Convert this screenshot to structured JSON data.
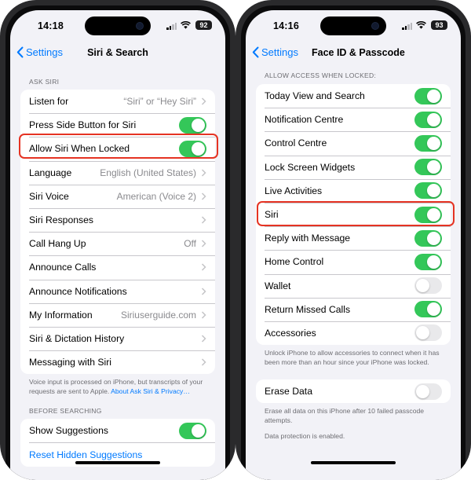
{
  "accent": "#007aff",
  "toggle_on_color": "#34c759",
  "highlight_color": "#e53323",
  "left_phone": {
    "status": {
      "time": "14:18",
      "battery": "92"
    },
    "nav": {
      "back_label": "Settings",
      "title": "Siri & Search"
    },
    "section_ask_siri": "ASK SIRI",
    "rows": [
      {
        "label": "Listen for",
        "value": "“Siri” or “Hey Siri”"
      },
      {
        "label": "Press Side Button for Siri",
        "toggle": "on"
      },
      {
        "label": "Allow Siri When Locked",
        "toggle": "on"
      },
      {
        "label": "Language",
        "value": "English (United States)"
      },
      {
        "label": "Siri Voice",
        "value": "American (Voice 2)"
      },
      {
        "label": "Siri Responses",
        "value": ""
      },
      {
        "label": "Call Hang Up",
        "value": "Off"
      },
      {
        "label": "Announce Calls",
        "value": ""
      },
      {
        "label": "Announce Notifications",
        "value": ""
      },
      {
        "label": "My Information",
        "value": "Siriuserguide.com"
      },
      {
        "label": "Siri & Dictation History",
        "value": ""
      },
      {
        "label": "Messaging with Siri",
        "value": ""
      }
    ],
    "footer_text": "Voice input is processed on iPhone, but transcripts of your requests are sent to Apple.",
    "footer_link": "About Ask Siri & Privacy…",
    "section_before_searching": "BEFORE SEARCHING",
    "show_suggestions": "Show Suggestions",
    "reset_hidden": "Reset Hidden Suggestions"
  },
  "right_phone": {
    "status": {
      "time": "14:16",
      "battery": "93"
    },
    "nav": {
      "back_label": "Settings",
      "title": "Face ID & Passcode"
    },
    "section_allow_access": "ALLOW ACCESS WHEN LOCKED:",
    "rows": [
      {
        "label": "Today View and Search",
        "toggle": "on"
      },
      {
        "label": "Notification Centre",
        "toggle": "on"
      },
      {
        "label": "Control Centre",
        "toggle": "on"
      },
      {
        "label": "Lock Screen Widgets",
        "toggle": "on"
      },
      {
        "label": "Live Activities",
        "toggle": "on"
      },
      {
        "label": "Siri",
        "toggle": "on"
      },
      {
        "label": "Reply with Message",
        "toggle": "on"
      },
      {
        "label": "Home Control",
        "toggle": "on"
      },
      {
        "label": "Wallet",
        "toggle": "off"
      },
      {
        "label": "Return Missed Calls",
        "toggle": "on"
      },
      {
        "label": "Accessories",
        "toggle": "off"
      }
    ],
    "accessories_footer": "Unlock iPhone to allow accessories to connect when it has been more than an hour since your iPhone was locked.",
    "erase_data": "Erase Data",
    "erase_data_toggle": "off",
    "erase_footer": "Erase all data on this iPhone after 10 failed passcode attempts.",
    "protection_footer": "Data protection is enabled."
  }
}
